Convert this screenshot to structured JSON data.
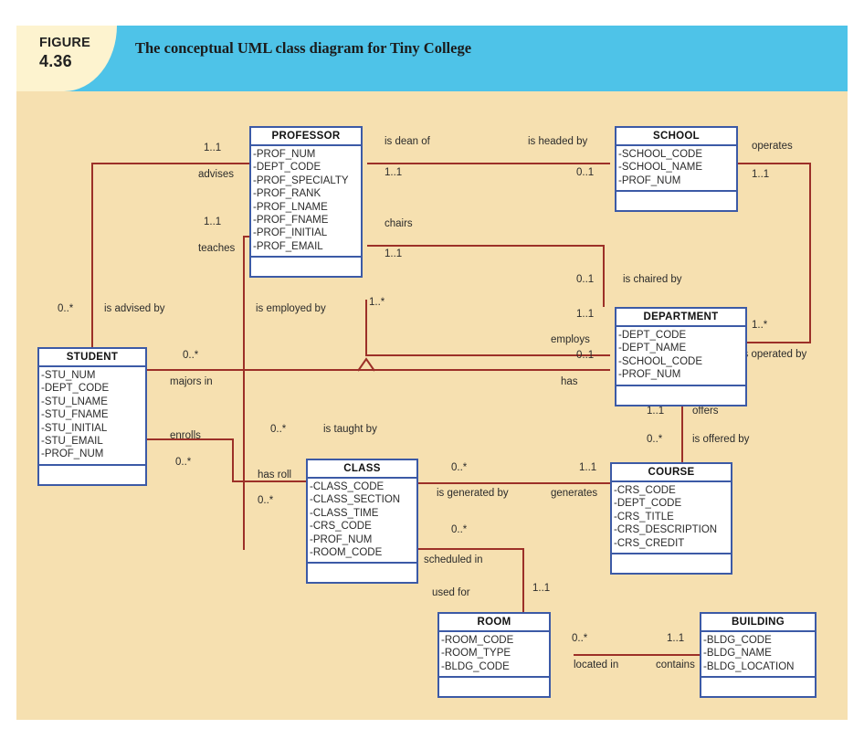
{
  "figure": {
    "label": "FIGURE",
    "number": "4.36",
    "title": "The conceptual UML class diagram for Tiny College",
    "band_color": "#4ec3e8",
    "tab_color": "#fdf3cf",
    "canvas_color": "#f6e0b0",
    "class_border_color": "#3c5aa6",
    "connector_color": "#9c3028"
  },
  "classes": [
    {
      "id": "professor",
      "name": "PROFESSOR",
      "attributes": [
        "PROF_NUM",
        "DEPT_CODE",
        "PROF_SPECIALTY",
        "PROF_RANK",
        "PROF_LNAME",
        "PROF_FNAME",
        "PROF_INITIAL",
        "PROF_EMAIL"
      ],
      "operations": []
    },
    {
      "id": "school",
      "name": "SCHOOL",
      "attributes": [
        "SCHOOL_CODE",
        "SCHOOL_NAME",
        "PROF_NUM"
      ],
      "operations": []
    },
    {
      "id": "department",
      "name": "DEPARTMENT",
      "attributes": [
        "DEPT_CODE",
        "DEPT_NAME",
        "SCHOOL_CODE",
        "PROF_NUM"
      ],
      "operations": []
    },
    {
      "id": "student",
      "name": "STUDENT",
      "attributes": [
        "STU_NUM",
        "DEPT_CODE",
        "STU_LNAME",
        "STU_FNAME",
        "STU_INITIAL",
        "STU_EMAIL",
        "PROF_NUM"
      ],
      "operations": []
    },
    {
      "id": "class",
      "name": "CLASS",
      "attributes": [
        "CLASS_CODE",
        "CLASS_SECTION",
        "CLASS_TIME",
        "CRS_CODE",
        "PROF_NUM",
        "ROOM_CODE"
      ],
      "operations": []
    },
    {
      "id": "course",
      "name": "COURSE",
      "attributes": [
        "CRS_CODE",
        "DEPT_CODE",
        "CRS_TITLE",
        "CRS_DESCRIPTION",
        "CRS_CREDIT"
      ],
      "operations": []
    },
    {
      "id": "room",
      "name": "ROOM",
      "attributes": [
        "ROOM_CODE",
        "ROOM_TYPE",
        "BLDG_CODE"
      ],
      "operations": []
    },
    {
      "id": "building",
      "name": "BUILDING",
      "attributes": [
        "BLDG_CODE",
        "BLDG_NAME",
        "BLDG_LOCATION"
      ],
      "operations": []
    }
  ],
  "relationships": [
    {
      "id": "advises",
      "from": "PROFESSOR",
      "to": "STUDENT",
      "role_near": "advises",
      "role_far": "is advised by",
      "mult_near": "1..1",
      "mult_far": "0..*"
    },
    {
      "id": "teaches",
      "from": "PROFESSOR",
      "to": "CLASS",
      "role_near": "teaches",
      "role_far": "is taught by",
      "mult_near": "1..1",
      "mult_far": "0..*"
    },
    {
      "id": "is_dean_of",
      "from": "PROFESSOR",
      "to": "SCHOOL",
      "role_near": "is dean of",
      "role_far": "is headed by",
      "mult_near": "1..1",
      "mult_far": "0..1"
    },
    {
      "id": "chairs",
      "from": "PROFESSOR",
      "to": "DEPARTMENT",
      "role_near": "chairs",
      "role_far": "is chaired by",
      "mult_near": "1..1",
      "mult_far": "0..1"
    },
    {
      "id": "is_employed_by",
      "from": "PROFESSOR",
      "to": "DEPARTMENT",
      "role_near": "is employed by",
      "role_far": "employs",
      "mult_near": "1..*",
      "mult_far": "1..1"
    },
    {
      "id": "operates",
      "from": "SCHOOL",
      "to": "DEPARTMENT",
      "role_near": "operates",
      "role_far": "is operated by",
      "mult_near": "1..1",
      "mult_far": "1..*"
    },
    {
      "id": "majors_in",
      "from": "STUDENT",
      "to": "DEPARTMENT",
      "role_near": "majors in",
      "role_far": "has",
      "mult_near": "0..*",
      "mult_far": "0..1"
    },
    {
      "id": "enrolls",
      "from": "STUDENT",
      "to": "CLASS",
      "role_near": "enrolls",
      "role_far": "has roll",
      "mult_near": "0..*",
      "mult_far": "0..*"
    },
    {
      "id": "generates",
      "from": "COURSE",
      "to": "CLASS",
      "role_near": "generates",
      "role_far": "is generated by",
      "mult_near": "1..1",
      "mult_far": "0..*"
    },
    {
      "id": "offers",
      "from": "DEPARTMENT",
      "to": "COURSE",
      "role_near": "offers",
      "role_far": "is offered by",
      "mult_near": "1..1",
      "mult_far": "0..*"
    },
    {
      "id": "scheduled_in",
      "from": "CLASS",
      "to": "ROOM",
      "role_near": "scheduled in",
      "role_far": "used for",
      "mult_near": "0..*",
      "mult_far": "1..1"
    },
    {
      "id": "located_in",
      "from": "ROOM",
      "to": "BUILDING",
      "role_near": "located in",
      "role_far": "contains",
      "mult_near": "0..*",
      "mult_far": "1..1"
    }
  ],
  "diagram_labels": {
    "advises": "advises",
    "is_advised_by": "is advised by",
    "teaches": "teaches",
    "is_taught_by": "is taught by",
    "is_dean_of": "is dean of",
    "is_headed_by": "is headed by",
    "chairs": "chairs",
    "is_chaired_by": "is chaired by",
    "is_employed_by": "is employed by",
    "employs": "employs",
    "operates": "operates",
    "is_operated_by": "is operated by",
    "majors_in": "majors in",
    "has": "has",
    "enrolls": "enrolls",
    "has_roll": "has roll",
    "generates": "generates",
    "is_generated_by": "is generated by",
    "offers": "offers",
    "is_offered_by": "is offered by",
    "scheduled_in": "scheduled in",
    "used_for": "used for",
    "located_in": "located in",
    "contains": "contains"
  },
  "multiplicities": {
    "advises_prof": "1..1",
    "advises_stu": "0..*",
    "teaches_prof": "1..1",
    "teaches_class": "0..*",
    "dean_prof": "1..1",
    "dean_school": "0..1",
    "chairs_prof": "1..1",
    "chairs_dept": "0..1",
    "employed_prof": "1..*",
    "employs_dept": "1..1",
    "operates_school": "1..1",
    "operated_dept": "1..*",
    "majors_stu": "0..*",
    "has_dept": "0..1",
    "enrolls_stu": "0..*",
    "hasroll_class": "0..*",
    "generated_class": "0..*",
    "generates_course": "1..1",
    "offers_dept": "1..1",
    "offered_course": "0..*",
    "scheduled_class": "0..*",
    "usedfor_room": "1..1",
    "located_room": "0..*",
    "contains_bldg": "1..1"
  }
}
